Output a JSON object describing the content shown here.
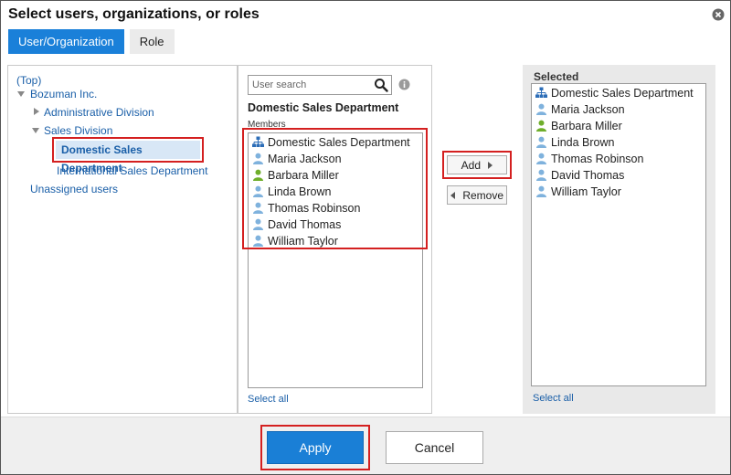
{
  "dialog": {
    "title": "Select users, organizations, or roles"
  },
  "tabs": [
    {
      "label": "User/Organization",
      "active": true
    },
    {
      "label": "Role",
      "active": false
    }
  ],
  "tree": {
    "top": "(Top)",
    "company": "Bozuman Inc.",
    "admin_division": "Administrative Division",
    "sales_division": "Sales Division",
    "domestic": "Domestic Sales Department",
    "international": "International Sales Department",
    "unassigned": "Unassigned users"
  },
  "members_pane": {
    "search_placeholder": "User search",
    "department_title": "Domestic Sales Department",
    "members_label": "Members",
    "select_all": "Select all",
    "items": [
      {
        "label": "Domestic Sales Department",
        "icon": "organization-icon"
      },
      {
        "label": "Maria Jackson",
        "icon": "user-icon"
      },
      {
        "label": "Barbara Miller",
        "icon": "user-admin-icon"
      },
      {
        "label": "Linda Brown",
        "icon": "user-icon"
      },
      {
        "label": "Thomas Robinson",
        "icon": "user-icon"
      },
      {
        "label": "David Thomas",
        "icon": "user-icon"
      },
      {
        "label": "William Taylor",
        "icon": "user-icon"
      }
    ]
  },
  "actions": {
    "add": "Add",
    "remove": "Remove"
  },
  "selected_pane": {
    "title": "Selected",
    "select_all": "Select all",
    "items": [
      {
        "label": "Domestic Sales Department",
        "icon": "organization-icon"
      },
      {
        "label": "Maria Jackson",
        "icon": "user-icon"
      },
      {
        "label": "Barbara Miller",
        "icon": "user-admin-icon"
      },
      {
        "label": "Linda Brown",
        "icon": "user-icon"
      },
      {
        "label": "Thomas Robinson",
        "icon": "user-icon"
      },
      {
        "label": "David Thomas",
        "icon": "user-icon"
      },
      {
        "label": "William Taylor",
        "icon": "user-icon"
      }
    ]
  },
  "footer": {
    "apply": "Apply",
    "cancel": "Cancel"
  },
  "colors": {
    "primary": "#1a7fd6",
    "link": "#1a5fa8",
    "highlight_border": "#d42020",
    "user_icon": "#7fb2dd",
    "admin_user_icon": "#6fae2b"
  }
}
